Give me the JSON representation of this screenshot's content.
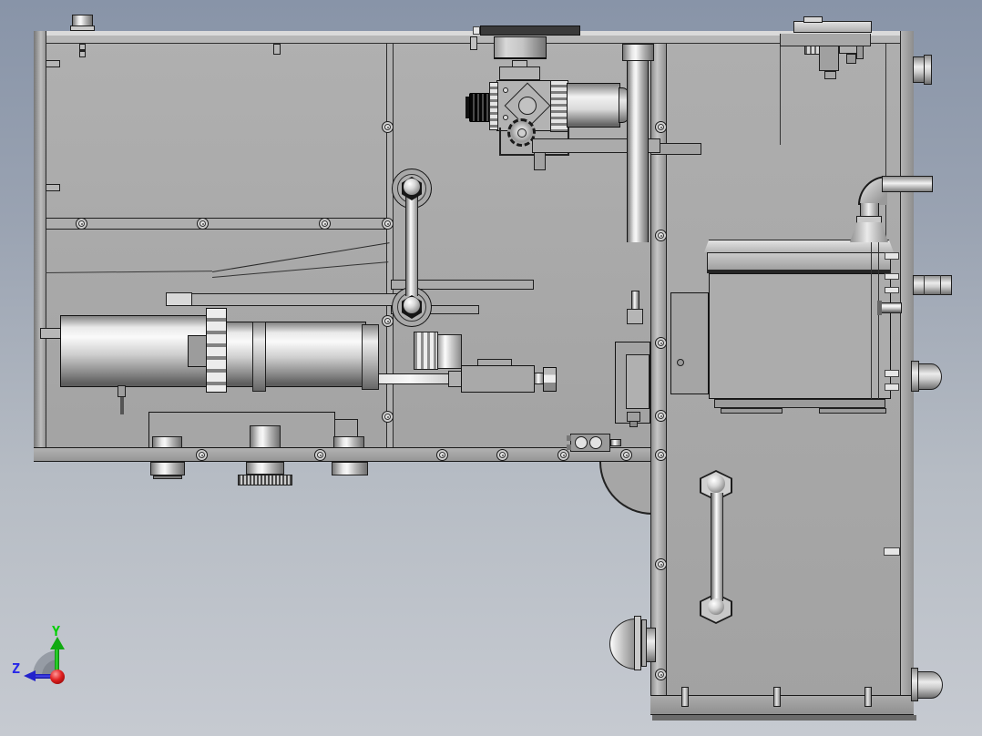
{
  "viewport": {
    "app": "3D CAD viewport",
    "view_orientation": "side view",
    "background": {
      "top": "#8894a8",
      "bottom": "#c6cad1"
    },
    "model_outline_color": "#1b1b1b",
    "model_base_gray": "#a8a8a8",
    "metal_highlight": "#fafafa",
    "metal_shadow": "#5e5e5e"
  },
  "triad": {
    "y_axis": {
      "label": "Y",
      "color": "#00c800",
      "direction": "up"
    },
    "z_axis": {
      "label": "Z",
      "color": "#2323d6",
      "direction": "left"
    },
    "origin": {
      "color": "#c81616",
      "shape": "sphere"
    }
  },
  "model": {
    "description": "L-shaped sheet-metal machine frame with pneumatic regulator, drive cylinder train, control box, piping and fasteners",
    "parts": [
      "frame-panel",
      "top-rail",
      "left-column",
      "right-column",
      "bottom-rail",
      "divider-rail",
      "pressure-regulator",
      "regulator-knob",
      "gauge-cap",
      "air-canister",
      "vertical-pipe",
      "drive-cylinder",
      "gear-block",
      "clamp-flange",
      "knurled-coupling",
      "spindle-shaft",
      "feed-block",
      "hex-nut",
      "tie-rod-upper",
      "tie-rod-lower",
      "mounting-plate",
      "mounting-feet",
      "knurled-wheel",
      "optical-sensor",
      "slide-bracket",
      "control-box",
      "elbow-fitting",
      "connector-boss",
      "dome-knob",
      "panel-screw"
    ]
  }
}
